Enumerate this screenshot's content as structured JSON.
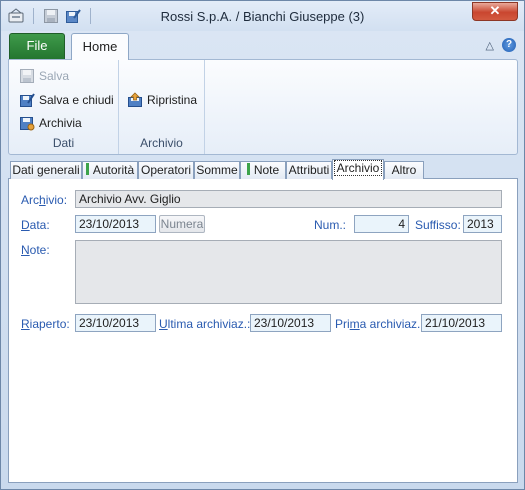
{
  "window": {
    "title": "Rossi S.p.A. / Bianchi Giuseppe (3)",
    "close_label": "✕"
  },
  "quick_access": {
    "icons": [
      "app-menu-icon",
      "save-icon",
      "save-close-icon"
    ]
  },
  "ribbon": {
    "tabs": {
      "file": "File",
      "home": "Home"
    },
    "controls": {
      "collapse": "△",
      "help": "?"
    },
    "groups": {
      "dati": {
        "label": "Dati",
        "buttons": {
          "salva": "Salva",
          "salva_chiudi": "Salva e chiudi",
          "archivia": "Archivia"
        }
      },
      "archivio": {
        "label": "Archivio",
        "buttons": {
          "ripristina": "Ripristina"
        }
      }
    }
  },
  "doc_tabs": {
    "dati_generali": "Dati generali",
    "autorita": "Autorità",
    "operatori": "Operatori",
    "somme": "Somme",
    "note": "Note",
    "attributi": "Attributi",
    "archivio": "Archivio",
    "altro": "Altro",
    "active": "Archivio"
  },
  "form": {
    "archivio": {
      "label_pre": "Arc",
      "label_u": "h",
      "label_post": "ivio:",
      "value": "Archivio Avv. Giglio"
    },
    "data": {
      "label_pre": "",
      "label_u": "D",
      "label_post": "ata:",
      "value": "23/10/2013"
    },
    "numera_button": "Numera",
    "num": {
      "label": "Num.:",
      "value": "4"
    },
    "suffisso": {
      "label": "Suffisso:",
      "value": "2013"
    },
    "note": {
      "label_pre": "",
      "label_u": "N",
      "label_post": "ote:",
      "value": ""
    },
    "riaperto": {
      "label_pre": "",
      "label_u": "R",
      "label_post": "iaperto:",
      "value": "23/10/2013"
    },
    "ultima": {
      "label_pre": "",
      "label_u": "U",
      "label_post": "ltima archiviaz.:",
      "value": "23/10/2013"
    },
    "prima": {
      "label_pre": "Pri",
      "label_u": "m",
      "label_post": "a archiviaz.:",
      "value": "21/10/2013"
    }
  }
}
